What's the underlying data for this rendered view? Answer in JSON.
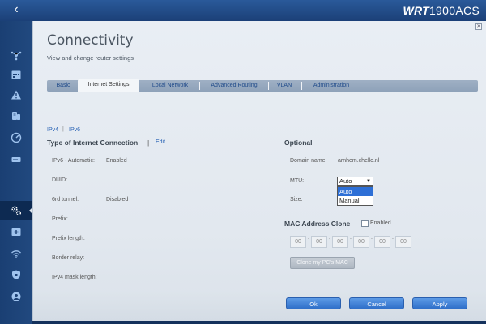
{
  "brand": {
    "prefix": "WRT",
    "model": "1900ACS"
  },
  "header": {
    "back_label": "‹"
  },
  "page": {
    "title": "Connectivity",
    "subtitle": "View and change router settings"
  },
  "tabs": [
    {
      "label": "Basic"
    },
    {
      "label": "Internet Settings"
    },
    {
      "label": "Local Network"
    },
    {
      "label": "Advanced Routing"
    },
    {
      "label": "VLAN"
    },
    {
      "label": "Administration"
    }
  ],
  "subtabs": {
    "ipv4": "IPv4",
    "divider": "|",
    "ipv6": "IPv6"
  },
  "connection": {
    "heading": "Type of Internet Connection",
    "pipe": "|",
    "edit": "Edit",
    "fields": [
      {
        "label": "IPv6 - Automatic:",
        "value": "Enabled"
      },
      {
        "label": "DUID:",
        "value": ""
      },
      {
        "label": "6rd tunnel:",
        "value": "Disabled"
      },
      {
        "label": "Prefix:",
        "value": ""
      },
      {
        "label": "Prefix length:",
        "value": ""
      },
      {
        "label": "Border relay:",
        "value": ""
      },
      {
        "label": "IPv4 mask length:",
        "value": ""
      }
    ]
  },
  "optional": {
    "heading": "Optional",
    "domain_label": "Domain name:",
    "domain_value": "arnhem.chello.nl",
    "mtu_label": "MTU:",
    "mtu_selected": "Auto",
    "mtu_arrow": "▼",
    "mtu_options": [
      "Auto",
      "Manual"
    ],
    "size_label": "Size:"
  },
  "mac_clone": {
    "heading": "MAC Address Clone",
    "enabled_label": "Enabled",
    "octets": [
      "00",
      "00",
      "00",
      "00",
      "00",
      "00"
    ],
    "colon": ":",
    "clone_button": "Clone my PC's MAC"
  },
  "footer": {
    "ok": "Ok",
    "cancel": "Cancel",
    "apply": "Apply"
  },
  "close": "✕",
  "colors": {
    "accent": "#2f6fc9",
    "topbar": "#1b4077",
    "sidebar": "#1a3f73",
    "link": "#2a63b5"
  }
}
